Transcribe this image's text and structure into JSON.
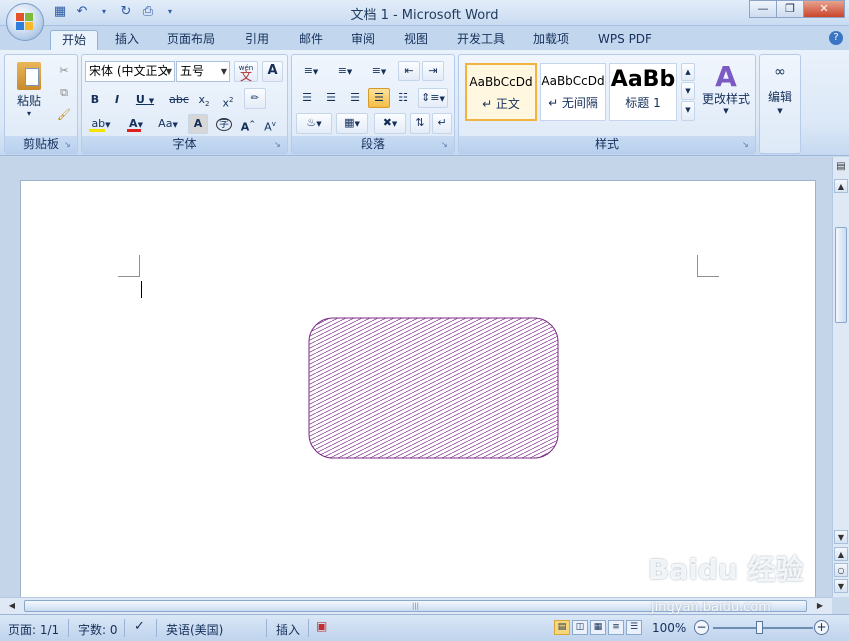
{
  "window": {
    "title": "文档 1 - Microsoft Word",
    "controls": [
      "—",
      "❐",
      "✕"
    ]
  },
  "tabs": [
    {
      "label": "开始",
      "active": true
    },
    {
      "label": "插入"
    },
    {
      "label": "页面布局"
    },
    {
      "label": "引用"
    },
    {
      "label": "邮件"
    },
    {
      "label": "审阅"
    },
    {
      "label": "视图"
    },
    {
      "label": "开发工具"
    },
    {
      "label": "加载项"
    },
    {
      "label": "WPS PDF"
    }
  ],
  "ribbon": {
    "clipboard": {
      "label": "剪贴板",
      "paste": "粘贴"
    },
    "font": {
      "label": "字体",
      "font_name": "宋体 (中文正文)",
      "font_size": "五号",
      "phonetic": "wén",
      "case": "Aa"
    },
    "paragraph": {
      "label": "段落"
    },
    "styles": {
      "label": "样式",
      "items": [
        {
          "sample": "AaBbCcDd",
          "name": "↵ 正文"
        },
        {
          "sample": "AaBbCcDd",
          "name": "↵ 无间隔"
        },
        {
          "sample": "AaBb",
          "name": "标题 1"
        }
      ],
      "change_styles": "更改样式"
    },
    "editing": {
      "label": "编辑"
    }
  },
  "colors": {
    "shape_stroke": "#7b2a86",
    "font_color_bar": "#e02020",
    "highlight_bar": "#f5e400"
  },
  "statusbar": {
    "page": "页面: 1/1",
    "words": "字数: 0",
    "language": "英语(美国)",
    "mode": "插入",
    "zoom": "100%"
  },
  "watermark": {
    "brand": "Baidu 经验",
    "url": "jingyan.baidu.com"
  }
}
